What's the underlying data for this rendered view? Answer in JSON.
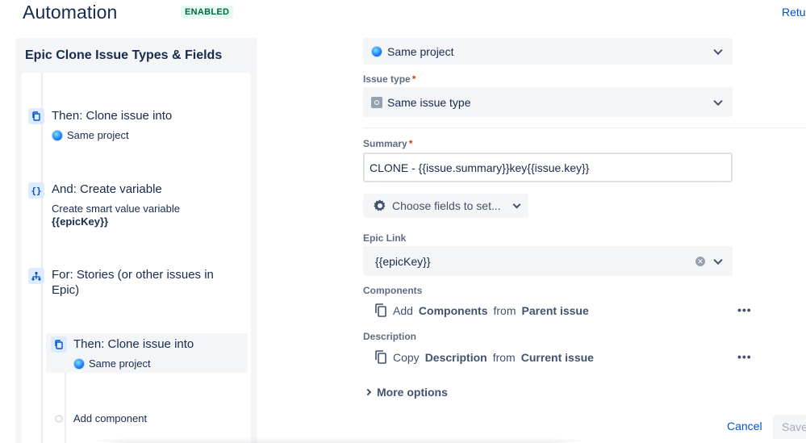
{
  "header": {
    "title": "Automation",
    "status": "ENABLED",
    "return_link": "Retur"
  },
  "rule": {
    "name": "Epic Clone Issue Types & Fields",
    "components": [
      {
        "title": "Then: Clone issue into",
        "subtitle": "Same project",
        "icon": "copy-icon"
      },
      {
        "title": "And: Create variable",
        "subtitle": "Create smart value variable",
        "subtitle_bold": "{{epicKey}}",
        "icon": "braces-icon"
      },
      {
        "title": "For: Stories (or other issues in Epic)",
        "icon": "branch-icon"
      },
      {
        "title": "Then: Clone issue into",
        "subtitle": "Same project",
        "icon": "copy-icon"
      }
    ],
    "add_component": "Add component"
  },
  "form": {
    "project_value": "Same project",
    "issue_type_label": "Issue type",
    "issue_type_value": "Same issue type",
    "summary_label": "Summary",
    "summary_value": "CLONE - {{issue.summary}}key{{issue.key}}",
    "choose_fields": "Choose fields to set...",
    "epic_link_label": "Epic Link",
    "epic_link_value": "{{epicKey}}",
    "components_label": "Components",
    "components_row": {
      "action": "Add",
      "field": "Components",
      "from": "from",
      "source": "Parent issue"
    },
    "description_label": "Description",
    "description_row": {
      "action": "Copy",
      "field": "Description",
      "from": "from",
      "source": "Current issue"
    },
    "more_options": "More options",
    "required_marker": "*"
  },
  "actions": {
    "cancel": "Cancel",
    "save": "Save"
  },
  "colors": {
    "link": "#0052CC",
    "enabled_bg": "#E3FCEF",
    "enabled_text": "#006644",
    "required": "#DE350B"
  }
}
